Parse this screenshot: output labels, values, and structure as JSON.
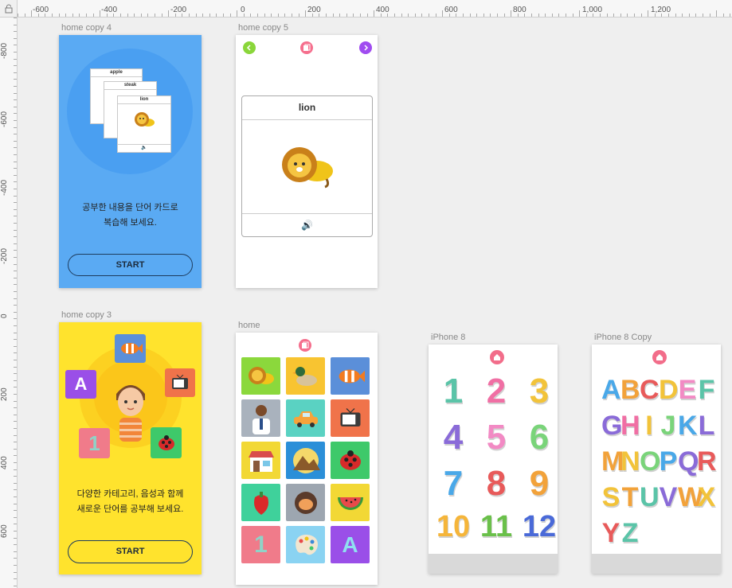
{
  "ruler": {
    "top_labels": [
      "-600",
      "-400",
      "-200",
      "0",
      "200",
      "400",
      "600",
      "800",
      "1,000",
      "1,200"
    ],
    "left_labels": [
      "-800",
      "-600",
      "-400",
      "-200",
      "0",
      "200",
      "400",
      "600"
    ]
  },
  "artboards": {
    "home_copy_4": {
      "label": "home copy 4",
      "cards": [
        "apple",
        "steak",
        "lion"
      ],
      "message_line1": "공부한 내용을 단어 카드로",
      "message_line2": "복습해 보세요.",
      "start": "START"
    },
    "home_copy_5": {
      "label": "home copy 5",
      "card_title": "lion",
      "speaker_icon": "speaker-icon",
      "prev_icon": "chevron-left-icon",
      "next_icon": "chevron-right-icon"
    },
    "home_copy_3": {
      "label": "home copy 3",
      "tile_letter": "A",
      "tile_number": "1",
      "message_line1": "다양한 카테고리, 음성과 함께",
      "message_line2": "새로운 단어를 공부해 보세요.",
      "start": "START"
    },
    "home": {
      "label": "home",
      "grid_icons": [
        "lion-icon",
        "duck-icon",
        "clownfish-icon",
        "doctor-icon",
        "car-icon",
        "tv-icon",
        "store-icon",
        "mountain-icon",
        "ladybug-icon",
        "pepper-icon",
        "chestnut-icon",
        "watermelon-icon",
        "number-one-icon",
        "palette-icon",
        "letter-a-icon"
      ],
      "number_tile": "1",
      "letter_tile": "A"
    },
    "iphone_8": {
      "label": "iPhone 8",
      "numbers": [
        "1",
        "2",
        "3",
        "4",
        "5",
        "6",
        "7",
        "8",
        "9",
        "10",
        "11",
        "12"
      ]
    },
    "iphone_8_copy": {
      "label": "iPhone 8 Copy",
      "letters": [
        "A",
        "B",
        "C",
        "D",
        "E",
        "F",
        "G",
        "H",
        "I",
        "J",
        "K",
        "L",
        "M",
        "N",
        "O",
        "P",
        "Q",
        "R",
        "S",
        "T",
        "U",
        "V",
        "W",
        "X",
        "Y",
        "Z"
      ]
    }
  },
  "colors": {
    "canvas": "#efefef",
    "blue_board": "#5aaaf3",
    "yellow_board": "#ffe32d",
    "home_button": "#f26d8a"
  }
}
